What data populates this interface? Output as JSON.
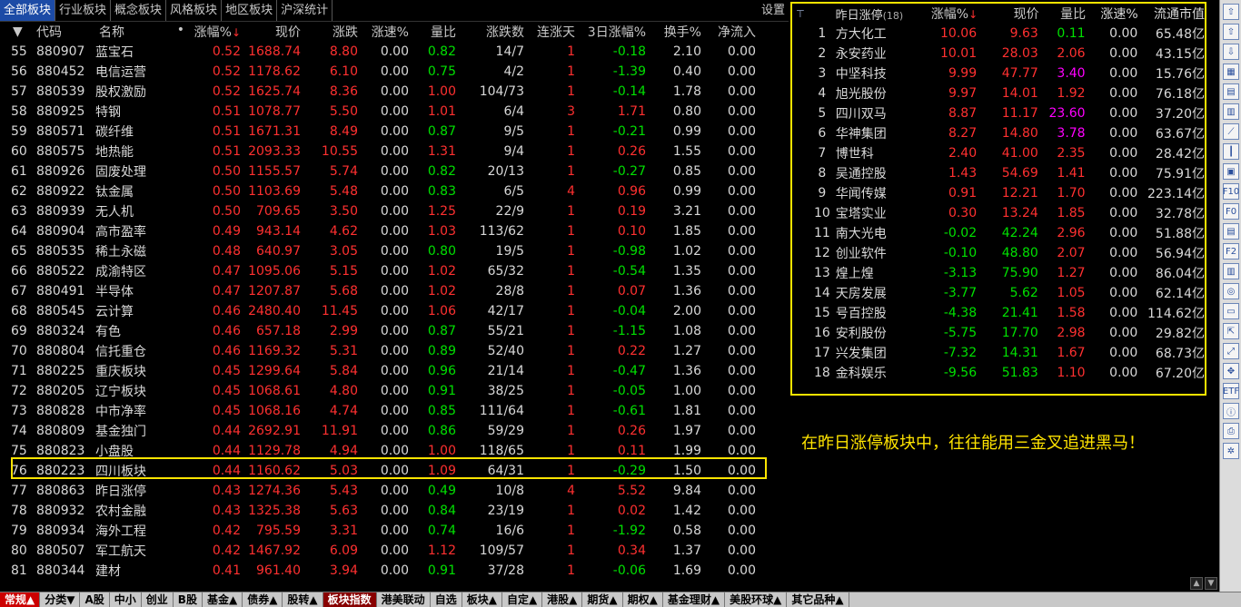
{
  "top_tabs": [
    "全部板块",
    "行业板块",
    "概念板块",
    "风格板块",
    "地区板块",
    "沪深统计"
  ],
  "settings_label": "设置",
  "main": {
    "headers": {
      "idx": "▼",
      "code": "代码",
      "name": "名称",
      "dot": "•",
      "pct": "涨幅%",
      "pct_arrow": "↓",
      "price": "现价",
      "chg": "涨跌",
      "speed": "涨速%",
      "vr": "量比",
      "ud": "涨跌数",
      "days": "连涨天",
      "r3": "3日涨幅%",
      "turn": "换手%",
      "net": "净流入"
    },
    "rows": [
      {
        "idx": "55",
        "code": "880907",
        "name": "蓝宝石",
        "pct": "0.52",
        "price": "1688.74",
        "chg": "8.80",
        "speed": "0.00",
        "vr": "0.82",
        "ud": "14/7",
        "days": "1",
        "r3": "-0.18",
        "turn": "2.10",
        "net": "0.00"
      },
      {
        "idx": "56",
        "code": "880452",
        "name": "电信运营",
        "pct": "0.52",
        "price": "1178.62",
        "chg": "6.10",
        "speed": "0.00",
        "vr": "0.75",
        "ud": "4/2",
        "days": "1",
        "r3": "-1.39",
        "turn": "0.40",
        "net": "0.00"
      },
      {
        "idx": "57",
        "code": "880539",
        "name": "股权激励",
        "pct": "0.52",
        "price": "1625.74",
        "chg": "8.36",
        "speed": "0.00",
        "vr": "1.00",
        "ud": "104/73",
        "days": "1",
        "r3": "-0.14",
        "turn": "1.78",
        "net": "0.00"
      },
      {
        "idx": "58",
        "code": "880925",
        "name": "特钢",
        "pct": "0.51",
        "price": "1078.77",
        "chg": "5.50",
        "speed": "0.00",
        "vr": "1.01",
        "ud": "6/4",
        "days": "3",
        "r3": "1.71",
        "turn": "0.80",
        "net": "0.00"
      },
      {
        "idx": "59",
        "code": "880571",
        "name": "碳纤维",
        "pct": "0.51",
        "price": "1671.31",
        "chg": "8.49",
        "speed": "0.00",
        "vr": "0.87",
        "ud": "9/5",
        "days": "1",
        "r3": "-0.21",
        "turn": "0.99",
        "net": "0.00"
      },
      {
        "idx": "60",
        "code": "880575",
        "name": "地热能",
        "pct": "0.51",
        "price": "2093.33",
        "chg": "10.55",
        "speed": "0.00",
        "vr": "1.31",
        "ud": "9/4",
        "days": "1",
        "r3": "0.26",
        "turn": "1.55",
        "net": "0.00"
      },
      {
        "idx": "61",
        "code": "880926",
        "name": "固废处理",
        "pct": "0.50",
        "price": "1155.57",
        "chg": "5.74",
        "speed": "0.00",
        "vr": "0.82",
        "ud": "20/13",
        "days": "1",
        "r3": "-0.27",
        "turn": "0.85",
        "net": "0.00"
      },
      {
        "idx": "62",
        "code": "880922",
        "name": "钛金属",
        "pct": "0.50",
        "price": "1103.69",
        "chg": "5.48",
        "speed": "0.00",
        "vr": "0.83",
        "ud": "6/5",
        "days": "4",
        "r3": "0.96",
        "turn": "0.99",
        "net": "0.00"
      },
      {
        "idx": "63",
        "code": "880939",
        "name": "无人机",
        "pct": "0.50",
        "price": "709.65",
        "chg": "3.50",
        "speed": "0.00",
        "vr": "1.25",
        "ud": "22/9",
        "days": "1",
        "r3": "0.19",
        "turn": "3.21",
        "net": "0.00"
      },
      {
        "idx": "64",
        "code": "880904",
        "name": "高市盈率",
        "pct": "0.49",
        "price": "943.14",
        "chg": "4.62",
        "speed": "0.00",
        "vr": "1.03",
        "ud": "113/62",
        "days": "1",
        "r3": "0.10",
        "turn": "1.85",
        "net": "0.00"
      },
      {
        "idx": "65",
        "code": "880535",
        "name": "稀土永磁",
        "pct": "0.48",
        "price": "640.97",
        "chg": "3.05",
        "speed": "0.00",
        "vr": "0.80",
        "ud": "19/5",
        "days": "1",
        "r3": "-0.98",
        "turn": "1.02",
        "net": "0.00"
      },
      {
        "idx": "66",
        "code": "880522",
        "name": "成渝特区",
        "pct": "0.47",
        "price": "1095.06",
        "chg": "5.15",
        "speed": "0.00",
        "vr": "1.02",
        "ud": "65/32",
        "days": "1",
        "r3": "-0.54",
        "turn": "1.35",
        "net": "0.00"
      },
      {
        "idx": "67",
        "code": "880491",
        "name": "半导体",
        "pct": "0.47",
        "price": "1207.87",
        "chg": "5.68",
        "speed": "0.00",
        "vr": "1.02",
        "ud": "28/8",
        "days": "1",
        "r3": "0.07",
        "turn": "1.36",
        "net": "0.00"
      },
      {
        "idx": "68",
        "code": "880545",
        "name": "云计算",
        "pct": "0.46",
        "price": "2480.40",
        "chg": "11.45",
        "speed": "0.00",
        "vr": "1.06",
        "ud": "42/17",
        "days": "1",
        "r3": "-0.04",
        "turn": "2.00",
        "net": "0.00"
      },
      {
        "idx": "69",
        "code": "880324",
        "name": "有色",
        "pct": "0.46",
        "price": "657.18",
        "chg": "2.99",
        "speed": "0.00",
        "vr": "0.87",
        "ud": "55/21",
        "days": "1",
        "r3": "-1.15",
        "turn": "1.08",
        "net": "0.00"
      },
      {
        "idx": "70",
        "code": "880804",
        "name": "信托重仓",
        "pct": "0.46",
        "price": "1169.32",
        "chg": "5.31",
        "speed": "0.00",
        "vr": "0.89",
        "ud": "52/40",
        "days": "1",
        "r3": "0.22",
        "turn": "1.27",
        "net": "0.00"
      },
      {
        "idx": "71",
        "code": "880225",
        "name": "重庆板块",
        "pct": "0.45",
        "price": "1299.64",
        "chg": "5.84",
        "speed": "0.00",
        "vr": "0.96",
        "ud": "21/14",
        "days": "1",
        "r3": "-0.47",
        "turn": "1.36",
        "net": "0.00"
      },
      {
        "idx": "72",
        "code": "880205",
        "name": "辽宁板块",
        "pct": "0.45",
        "price": "1068.61",
        "chg": "4.80",
        "speed": "0.00",
        "vr": "0.91",
        "ud": "38/25",
        "days": "1",
        "r3": "-0.05",
        "turn": "1.00",
        "net": "0.00"
      },
      {
        "idx": "73",
        "code": "880828",
        "name": "中市净率",
        "pct": "0.45",
        "price": "1068.16",
        "chg": "4.74",
        "speed": "0.00",
        "vr": "0.85",
        "ud": "111/64",
        "days": "1",
        "r3": "-0.61",
        "turn": "1.81",
        "net": "0.00"
      },
      {
        "idx": "74",
        "code": "880809",
        "name": "基金独门",
        "pct": "0.44",
        "price": "2692.91",
        "chg": "11.91",
        "speed": "0.00",
        "vr": "0.86",
        "ud": "59/29",
        "days": "1",
        "r3": "0.26",
        "turn": "1.97",
        "net": "0.00"
      },
      {
        "idx": "75",
        "code": "880823",
        "name": "小盘股",
        "pct": "0.44",
        "price": "1129.78",
        "chg": "4.94",
        "speed": "0.00",
        "vr": "1.00",
        "ud": "118/65",
        "days": "1",
        "r3": "0.11",
        "turn": "1.99",
        "net": "0.00"
      },
      {
        "idx": "76",
        "code": "880223",
        "name": "四川板块",
        "pct": "0.44",
        "price": "1160.62",
        "chg": "5.03",
        "speed": "0.00",
        "vr": "1.09",
        "ud": "64/31",
        "days": "1",
        "r3": "-0.29",
        "turn": "1.50",
        "net": "0.00"
      },
      {
        "idx": "77",
        "code": "880863",
        "name": "昨日涨停",
        "pct": "0.43",
        "price": "1274.36",
        "chg": "5.43",
        "speed": "0.00",
        "vr": "0.49",
        "ud": "10/8",
        "days": "4",
        "r3": "5.52",
        "turn": "9.84",
        "net": "0.00"
      },
      {
        "idx": "78",
        "code": "880932",
        "name": "农村金融",
        "pct": "0.43",
        "price": "1325.38",
        "chg": "5.63",
        "speed": "0.00",
        "vr": "0.84",
        "ud": "23/19",
        "days": "1",
        "r3": "0.02",
        "turn": "1.42",
        "net": "0.00"
      },
      {
        "idx": "79",
        "code": "880934",
        "name": "海外工程",
        "pct": "0.42",
        "price": "795.59",
        "chg": "3.31",
        "speed": "0.00",
        "vr": "0.74",
        "ud": "16/6",
        "days": "1",
        "r3": "-1.92",
        "turn": "0.58",
        "net": "0.00"
      },
      {
        "idx": "80",
        "code": "880507",
        "name": "军工航天",
        "pct": "0.42",
        "price": "1467.92",
        "chg": "6.09",
        "speed": "0.00",
        "vr": "1.12",
        "ud": "109/57",
        "days": "1",
        "r3": "0.34",
        "turn": "1.37",
        "net": "0.00"
      },
      {
        "idx": "81",
        "code": "880344",
        "name": "建材",
        "pct": "0.41",
        "price": "961.40",
        "chg": "3.94",
        "speed": "0.00",
        "vr": "0.91",
        "ud": "37/28",
        "days": "1",
        "r3": "-0.06",
        "turn": "1.69",
        "net": "0.00"
      }
    ]
  },
  "right_panel": {
    "headers": {
      "pin": "⊤",
      "name": "昨日涨停",
      "count": "(18)",
      "pct": "涨幅%",
      "pct_arrow": "↓",
      "price": "现价",
      "vr": "量比",
      "speed": "涨速%",
      "mcap": "流通市值"
    },
    "rows": [
      {
        "idx": "1",
        "name": "方大化工",
        "pct": "10.06",
        "price": "9.63",
        "vr": "0.11",
        "speed": "0.00",
        "mcap": "65.48",
        "unit": "亿"
      },
      {
        "idx": "2",
        "name": "永安药业",
        "pct": "10.01",
        "price": "28.03",
        "vr": "2.06",
        "speed": "0.00",
        "mcap": "43.15",
        "unit": "亿"
      },
      {
        "idx": "3",
        "name": "中坚科技",
        "pct": "9.99",
        "price": "47.77",
        "vr": "3.40",
        "speed": "0.00",
        "mcap": "15.76",
        "unit": "亿"
      },
      {
        "idx": "4",
        "name": "旭光股份",
        "pct": "9.97",
        "price": "14.01",
        "vr": "1.92",
        "speed": "0.00",
        "mcap": "76.18",
        "unit": "亿"
      },
      {
        "idx": "5",
        "name": "四川双马",
        "pct": "8.87",
        "price": "11.17",
        "vr": "23.60",
        "speed": "0.00",
        "mcap": "37.20",
        "unit": "亿"
      },
      {
        "idx": "6",
        "name": "华神集团",
        "pct": "8.27",
        "price": "14.80",
        "vr": "3.78",
        "speed": "0.00",
        "mcap": "63.67",
        "unit": "亿"
      },
      {
        "idx": "7",
        "name": "博世科",
        "pct": "2.40",
        "price": "41.00",
        "vr": "2.35",
        "speed": "0.00",
        "mcap": "28.42",
        "unit": "亿"
      },
      {
        "idx": "8",
        "name": "吴通控股",
        "pct": "1.43",
        "price": "54.69",
        "vr": "1.41",
        "speed": "0.00",
        "mcap": "75.91",
        "unit": "亿"
      },
      {
        "idx": "9",
        "name": "华闻传媒",
        "pct": "0.91",
        "price": "12.21",
        "vr": "1.70",
        "speed": "0.00",
        "mcap": "223.14",
        "unit": "亿"
      },
      {
        "idx": "10",
        "name": "宝塔实业",
        "pct": "0.30",
        "price": "13.24",
        "vr": "1.85",
        "speed": "0.00",
        "mcap": "32.78",
        "unit": "亿"
      },
      {
        "idx": "11",
        "name": "南大光电",
        "pct": "-0.02",
        "price": "42.24",
        "vr": "2.96",
        "speed": "0.00",
        "mcap": "51.88",
        "unit": "亿"
      },
      {
        "idx": "12",
        "name": "创业软件",
        "pct": "-0.10",
        "price": "48.80",
        "vr": "2.07",
        "speed": "0.00",
        "mcap": "56.94",
        "unit": "亿"
      },
      {
        "idx": "13",
        "name": "煌上煌",
        "pct": "-3.13",
        "price": "75.90",
        "vr": "1.27",
        "speed": "0.00",
        "mcap": "86.04",
        "unit": "亿"
      },
      {
        "idx": "14",
        "name": "天房发展",
        "pct": "-3.77",
        "price": "5.62",
        "vr": "1.05",
        "speed": "0.00",
        "mcap": "62.14",
        "unit": "亿"
      },
      {
        "idx": "15",
        "name": "号百控股",
        "pct": "-4.38",
        "price": "21.41",
        "vr": "1.58",
        "speed": "0.00",
        "mcap": "114.62",
        "unit": "亿"
      },
      {
        "idx": "16",
        "name": "安利股份",
        "pct": "-5.75",
        "price": "17.70",
        "vr": "2.98",
        "speed": "0.00",
        "mcap": "29.82",
        "unit": "亿"
      },
      {
        "idx": "17",
        "name": "兴发集团",
        "pct": "-7.32",
        "price": "14.31",
        "vr": "1.67",
        "speed": "0.00",
        "mcap": "68.73",
        "unit": "亿"
      },
      {
        "idx": "18",
        "name": "金科娱乐",
        "pct": "-9.56",
        "price": "51.83",
        "vr": "1.10",
        "speed": "0.00",
        "mcap": "67.20",
        "unit": "亿"
      }
    ]
  },
  "annotation_note": "在昨日涨停板块中，往往能用三金叉追进黑马！",
  "toolbar_icons": [
    "up-arrow-icon",
    "up-icon",
    "down-icon",
    "grid-icon",
    "list-icon",
    "table-icon",
    "line-chart-icon",
    "candle-chart-icon",
    "news-icon",
    "f10-icon",
    "f10b-icon",
    "doc-icon",
    "f2-icon",
    "bar-icon",
    "circle-icon",
    "folder-icon",
    "share-icon",
    "expand-icon",
    "move-icon",
    "etf-icon",
    "info-icon",
    "printer-icon",
    "gear-icon"
  ],
  "toolbar_glyphs": [
    "⇧",
    "⇧",
    "⇩",
    "▦",
    "▤",
    "▥",
    "⟋",
    "┃",
    "▣",
    "F10",
    "F0",
    "▤",
    "F2",
    "▥",
    "◎",
    "▭",
    "⇱",
    "⤢",
    "✥",
    "ETF",
    "ⓘ",
    "⎙",
    "✲"
  ],
  "bottom_tabs": [
    {
      "label": "常规▲",
      "state": "active"
    },
    {
      "label": "分类▼",
      "state": ""
    },
    {
      "label": "A股",
      "state": ""
    },
    {
      "label": "中小",
      "state": ""
    },
    {
      "label": "创业",
      "state": ""
    },
    {
      "label": "B股",
      "state": ""
    },
    {
      "label": "基金▲",
      "state": ""
    },
    {
      "label": "债券▲",
      "state": ""
    },
    {
      "label": "股转▲",
      "state": ""
    },
    {
      "label": "板块指数",
      "state": "hl"
    },
    {
      "label": "港美联动",
      "state": ""
    },
    {
      "label": "自选",
      "state": ""
    },
    {
      "label": "板块▲",
      "state": ""
    },
    {
      "label": "自定▲",
      "state": ""
    },
    {
      "label": "港股▲",
      "state": ""
    },
    {
      "label": "期货▲",
      "state": ""
    },
    {
      "label": "期权▲",
      "state": ""
    },
    {
      "label": "基金理财▲",
      "state": ""
    },
    {
      "label": "美股环球▲",
      "state": ""
    },
    {
      "label": "其它品种▲",
      "state": ""
    }
  ],
  "scroll_labels": [
    "▲",
    "▼"
  ]
}
